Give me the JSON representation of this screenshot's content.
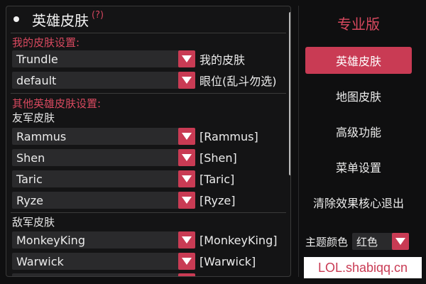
{
  "header": {
    "title": "英雄皮肤",
    "help": "(?)"
  },
  "sections": {
    "my_skin_label": "我的皮肤设置:",
    "other_skin_label": "其他英雄皮肤设置:",
    "ally_label": "友军皮肤",
    "enemy_label": "敌军皮肤"
  },
  "my_rows": [
    {
      "value": "Trundle",
      "label": "我的皮肤"
    },
    {
      "value": "default",
      "label": "眼位(乱斗勿选)"
    }
  ],
  "ally_rows": [
    {
      "value": "Rammus",
      "label": "[Rammus]"
    },
    {
      "value": "Shen",
      "label": "[Shen]"
    },
    {
      "value": "Taric",
      "label": "[Taric]"
    },
    {
      "value": "Ryze",
      "label": "[Ryze]"
    }
  ],
  "enemy_rows": [
    {
      "value": "MonkeyKing",
      "label": "[MonkeyKing]"
    },
    {
      "value": "Warwick",
      "label": "[Warwick]"
    }
  ],
  "sidebar": {
    "edition": "专业版",
    "items": [
      {
        "label": "英雄皮肤",
        "active": true
      },
      {
        "label": "地图皮肤"
      },
      {
        "label": "高级功能"
      },
      {
        "label": "菜单设置"
      },
      {
        "label": "清除效果核心退出"
      }
    ],
    "theme_label": "主题颜色",
    "theme_value": "红色"
  },
  "site_link": "LOL.shabiqq.cn",
  "colors": {
    "accent": "#c93b54",
    "accent_text": "#d8495f",
    "background": "#0f0f10"
  }
}
